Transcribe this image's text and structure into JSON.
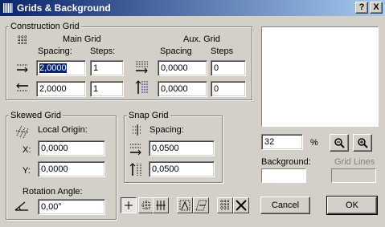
{
  "window": {
    "title": "Grids & Background",
    "help_button": "?",
    "close_button": "X"
  },
  "construction_grid": {
    "group_label": "Construction Grid",
    "main_grid_label": "Main Grid",
    "aux_grid_label": "Aux. Grid",
    "spacing_header": "Spacing:",
    "steps_header": "Steps:",
    "aux_spacing_header": "Spacing",
    "aux_steps_header": "Steps",
    "main_h_spacing": "2,0000",
    "main_h_steps": "1",
    "main_v_spacing": "2,0000",
    "main_v_steps": "1",
    "aux_h_spacing": "0,0000",
    "aux_h_steps": "0",
    "aux_v_spacing": "0,0000",
    "aux_v_steps": "0"
  },
  "skewed_grid": {
    "group_label": "Skewed Grid",
    "local_origin_label": "Local Origin:",
    "x_label": "X:",
    "x_value": "0,0000",
    "y_label": "Y:",
    "y_value": "0,0000",
    "rotation_label": "Rotation Angle:",
    "rotation_value": "0,00°"
  },
  "snap_grid": {
    "group_label": "Snap Grid",
    "spacing_label": "Spacing:",
    "h_value": "0,0500",
    "v_value": "0,0500"
  },
  "preview": {
    "zoom_value": "32",
    "zoom_unit": "%",
    "background_label": "Background:",
    "grid_lines_label": "Grid Lines",
    "background_color": "#ffffff"
  },
  "buttons": {
    "cancel": "Cancel",
    "ok": "OK"
  },
  "icons": {
    "zoom_out": "zoom-out-icon",
    "zoom_in": "zoom-in-icon"
  }
}
